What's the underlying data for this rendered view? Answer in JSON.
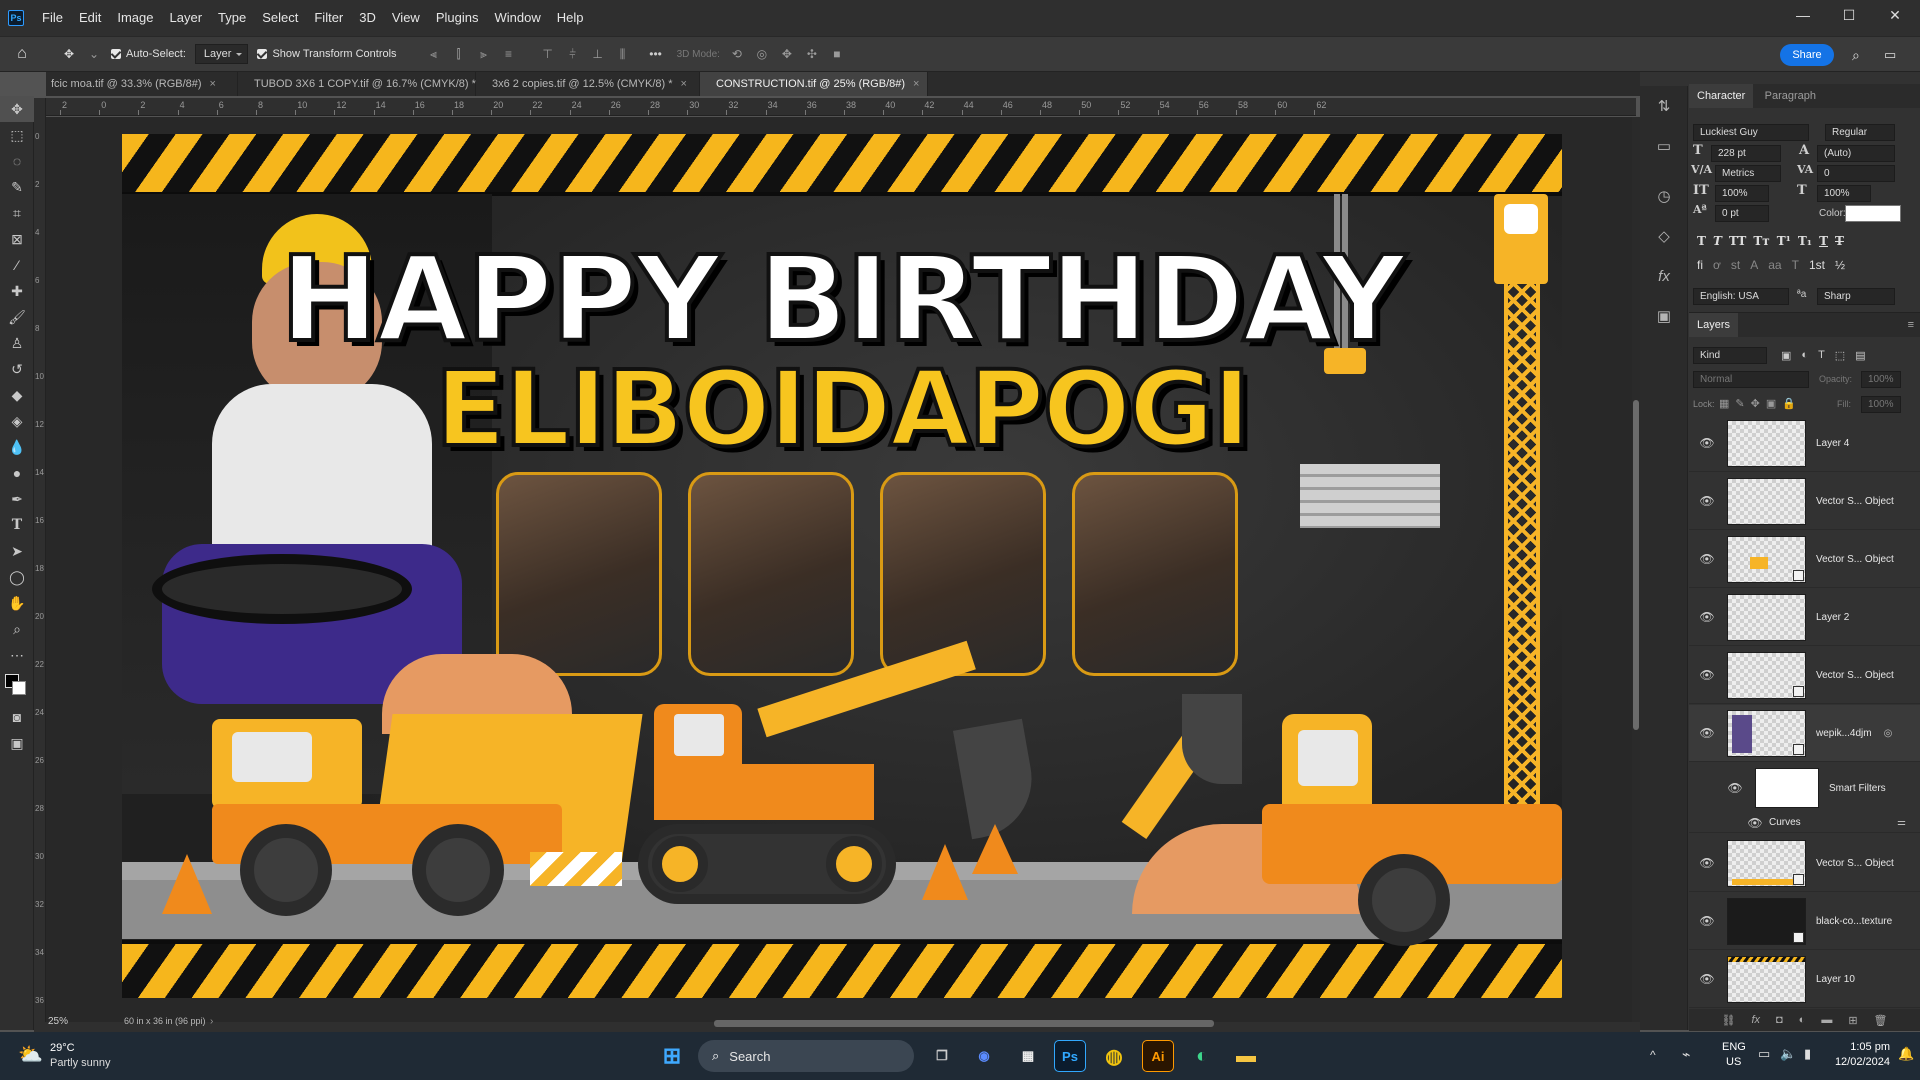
{
  "menubar": {
    "logo": "Ps",
    "items": [
      "File",
      "Edit",
      "Image",
      "Layer",
      "Type",
      "Select",
      "Filter",
      "3D",
      "View",
      "Plugins",
      "Window",
      "Help"
    ],
    "window_controls": [
      "—",
      "☐",
      "✕"
    ]
  },
  "options": {
    "auto_select": "Auto-Select:",
    "auto_select_target": "Layer",
    "show_transform": "Show Transform Controls",
    "mode_3d": "3D Mode:",
    "share": "Share"
  },
  "tabs": [
    {
      "label": "fcic moa.tif @ 33.3% (RGB/8#)",
      "close": "×"
    },
    {
      "label": "TUBOD 3X6 1 COPY.tif @ 16.7% (CMYK/8) *",
      "close": "×"
    },
    {
      "label": "3x6 2 copies.tif @ 12.5% (CMYK/8) *",
      "close": "×"
    },
    {
      "label": "CONSTRUCTION.tif @ 25% (RGB/8#)",
      "close": "×"
    }
  ],
  "ruler": {
    "h_labels": [
      "2",
      "0",
      "2",
      "4",
      "6",
      "8",
      "10",
      "12",
      "14",
      "16",
      "18",
      "20",
      "22",
      "24",
      "26",
      "28",
      "30",
      "32",
      "34",
      "36",
      "38",
      "40",
      "42",
      "44",
      "46",
      "48",
      "50",
      "52",
      "54",
      "56",
      "58",
      "60",
      "62"
    ],
    "v_labels": [
      "0",
      "2",
      "4",
      "6",
      "8",
      "10",
      "12",
      "14",
      "16",
      "18",
      "20",
      "22",
      "24",
      "26",
      "28",
      "30",
      "32",
      "34",
      "36"
    ]
  },
  "artwork": {
    "title_line1": "HAPPY BIRTHDAY",
    "title_line2": "ELIBOIDAPOGI",
    "colors": {
      "stripe_yellow": "#f6b61c",
      "title_yellow": "#f7c51f",
      "machine_orange": "#f08a1c",
      "machine_yellow": "#f6b427"
    }
  },
  "status": {
    "zoom": "25%",
    "doc_size": "60 in x 36 in (96 ppi)"
  },
  "character": {
    "tabs": [
      "Character",
      "Paragraph"
    ],
    "font_family": "Luckiest Guy",
    "font_style": "Regular",
    "size": "228 pt",
    "leading": "(Auto)",
    "kerning": "Metrics",
    "tracking": "0",
    "vscale": "100%",
    "hscale": "100%",
    "baseline": "0 pt",
    "color_label": "Color:",
    "language": "English: USA",
    "antialias": "Sharp",
    "aa_glyph": "ªa"
  },
  "layers": {
    "title": "Layers",
    "filter_kind": "Kind",
    "blend_mode": "Normal",
    "opacity_label": "Opacity:",
    "opacity": "100%",
    "lock_label": "Lock:",
    "fill_label": "Fill:",
    "fill": "100%",
    "items": [
      {
        "name": "Layer 4"
      },
      {
        "name": "Vector S... Object"
      },
      {
        "name": "Vector S... Object"
      },
      {
        "name": "Layer 2"
      },
      {
        "name": "Vector S... Object"
      },
      {
        "name": "wepik...4djm"
      },
      {
        "name": "Smart Filters"
      },
      {
        "name": "Curves"
      },
      {
        "name": "Vector S... Object"
      },
      {
        "name": "black-co...texture"
      },
      {
        "name": "Layer 10"
      }
    ]
  },
  "taskbar": {
    "weather_temp": "29°C",
    "weather_desc": "Partly sunny",
    "search": "Search",
    "lang1": "ENG",
    "lang2": "US",
    "time": "1:05 pm",
    "date": "12/02/2024"
  }
}
